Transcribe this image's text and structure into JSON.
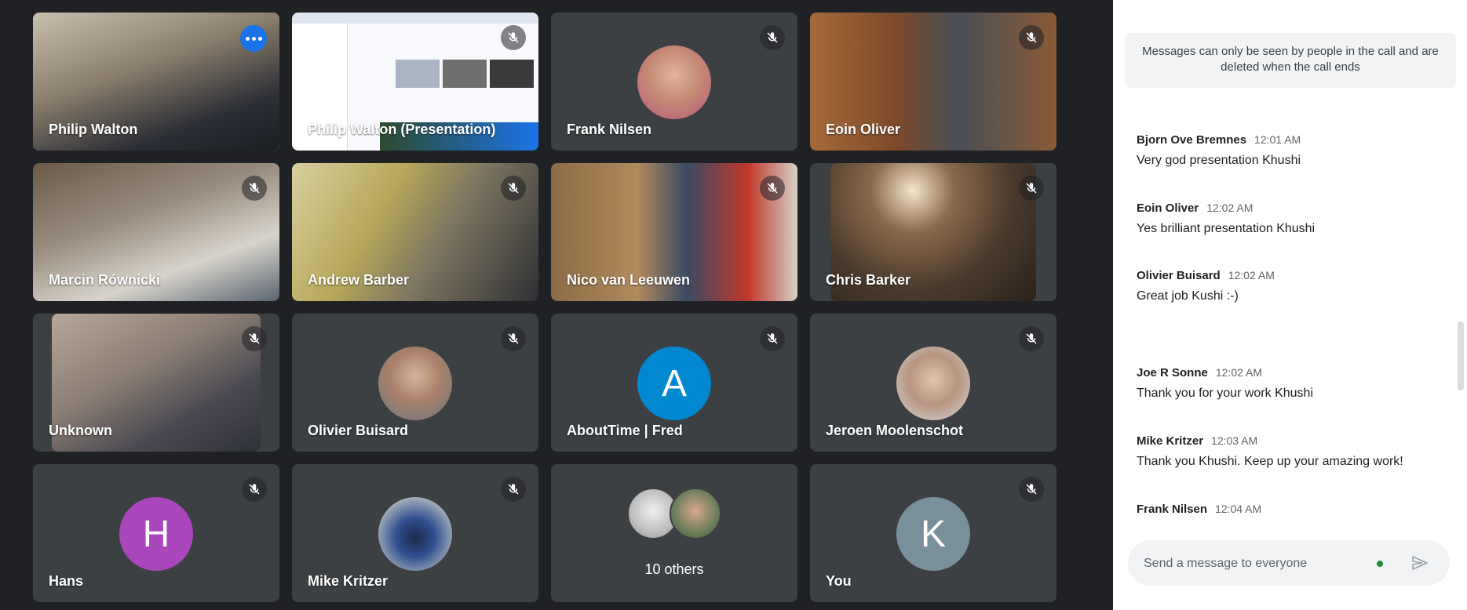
{
  "tiles": [
    {
      "name": "Philip Walton"
    },
    {
      "name": "Philip Walton (Presentation)"
    },
    {
      "name": "Frank Nilsen"
    },
    {
      "name": "Eoin Oliver"
    },
    {
      "name": "Marcin Równicki"
    },
    {
      "name": "Andrew Barber"
    },
    {
      "name": "Nico van Leeuwen"
    },
    {
      "name": "Chris Barker"
    },
    {
      "name": "Unknown"
    },
    {
      "name": "Olivier Buisard"
    },
    {
      "name": "AboutTime | Fred",
      "initial": "A"
    },
    {
      "name": "Jeroen Moolenschot"
    },
    {
      "name": "Hans",
      "initial": "H"
    },
    {
      "name": "Mike Kritzer"
    },
    {
      "name": "10 others"
    },
    {
      "name": "You",
      "initial": "K"
    }
  ],
  "colors": {
    "avatar_a": "#0288d1",
    "avatar_h": "#ab47bc",
    "avatar_k": "#78909c",
    "active_border": "#8ab4f8"
  },
  "chat": {
    "notice": "Messages can only be seen by people in the call and are deleted when the call ends",
    "messages": [
      {
        "sender": "Bjorn Ove Bremnes",
        "time": "12:01 AM",
        "text": "Very god presentation Khushi"
      },
      {
        "sender": "Eoin Oliver",
        "time": "12:02 AM",
        "text": "Yes brilliant presentation Khushi"
      },
      {
        "sender": "Olivier Buisard",
        "time": "12:02 AM",
        "text": "Great job Kushi :-)"
      },
      {
        "sender": "Joe R Sonne",
        "time": "12:02 AM",
        "text": "Thank you for your work Khushi"
      },
      {
        "sender": "Mike Kritzer",
        "time": "12:03 AM",
        "text": "Thank you Khushi. Keep up your amazing work!"
      },
      {
        "sender": "Frank Nilsen",
        "time": "12:04 AM",
        "text": ""
      }
    ],
    "input_placeholder": "Send a message to everyone"
  }
}
